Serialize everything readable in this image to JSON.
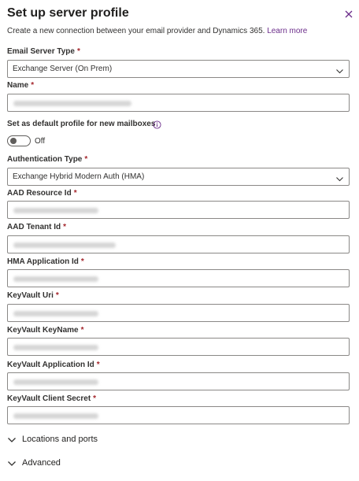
{
  "panel": {
    "title": "Set up server profile",
    "close_icon": "close-icon",
    "subtitle": "Create a new connection between your email provider and Dynamics 365.",
    "learn_more": "Learn more"
  },
  "fields": {
    "email_server_type": {
      "label": "Email Server Type",
      "required_mark": "*",
      "value": "Exchange Server (On Prem)"
    },
    "name": {
      "label": "Name",
      "required_mark": "*"
    },
    "default_profile": {
      "label": "Set as default profile for new mailboxes",
      "toggle_state": "Off",
      "info_icon": "info-icon"
    },
    "authentication_type": {
      "label": "Authentication Type",
      "required_mark": "*",
      "value": "Exchange Hybrid Modern Auth (HMA)"
    },
    "aad_resource_id": {
      "label": "AAD Resource Id",
      "required_mark": "*"
    },
    "aad_tenant_id": {
      "label": "AAD Tenant Id",
      "required_mark": "*"
    },
    "hma_application_id": {
      "label": "HMA Application Id",
      "required_mark": "*"
    },
    "keyvault_uri": {
      "label": "KeyVault Uri",
      "required_mark": "*"
    },
    "keyvault_keyname": {
      "label": "KeyVault KeyName",
      "required_mark": "*"
    },
    "keyvault_application_id": {
      "label": "KeyVault Application Id",
      "required_mark": "*"
    },
    "keyvault_client_secret": {
      "label": "KeyVault Client Secret",
      "required_mark": "*"
    }
  },
  "sections": {
    "locations_ports": "Locations and ports",
    "advanced": "Advanced"
  },
  "colors": {
    "accent_link": "#6b2d8a",
    "required": "#a4262c",
    "border": "#8a8886"
  }
}
